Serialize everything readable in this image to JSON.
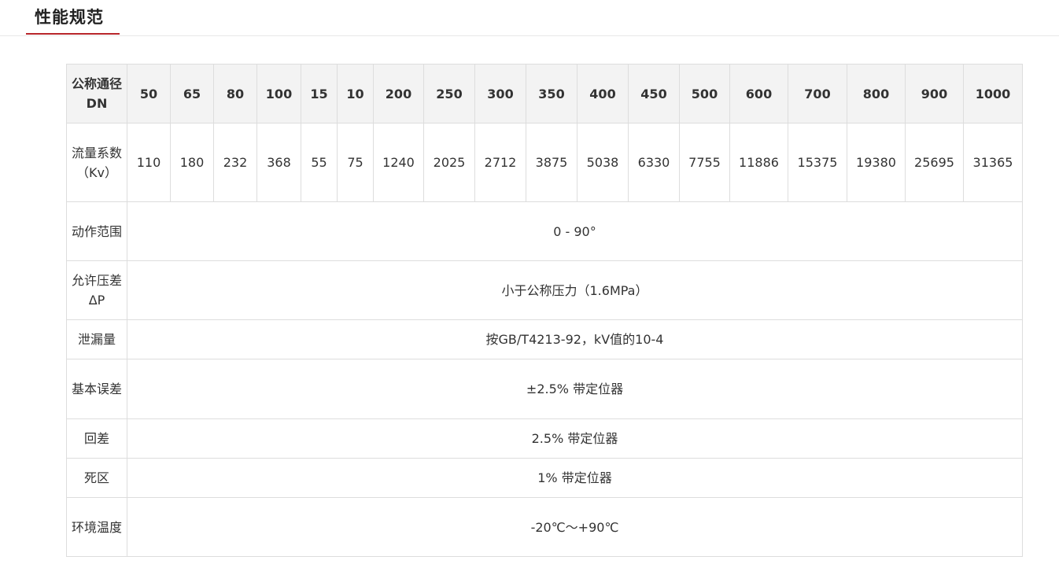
{
  "section": {
    "title": "性能规范"
  },
  "table": {
    "header_label": "公称通径DN",
    "dn_values": [
      "50",
      "65",
      "80",
      "100",
      "15",
      "10",
      "200",
      "250",
      "300",
      "350",
      "400",
      "450",
      "500",
      "600",
      "700",
      "800",
      "900",
      "1000"
    ],
    "kv_label": "流量系数（Kv）",
    "kv_values": [
      "110",
      "180",
      "232",
      "368",
      "55",
      "75",
      "1240",
      "2025",
      "2712",
      "3875",
      "5038",
      "6330",
      "7755",
      "11886",
      "15375",
      "19380",
      "25695",
      "31365"
    ],
    "rows": [
      {
        "label": "动作范围",
        "value": "0 - 90°"
      },
      {
        "label": "允许压差ΔP",
        "value": "小于公称压力（1.6MPa）"
      },
      {
        "label": "泄漏量",
        "value": "按GB/T4213-92，kV值的10-4"
      },
      {
        "label": "基本误差",
        "value": "±2.5% 带定位器"
      },
      {
        "label": "回差",
        "value": "2.5% 带定位器"
      },
      {
        "label": "死区",
        "value": "1% 带定位器"
      },
      {
        "label": "环境温度",
        "value": "-20℃～+90℃"
      }
    ]
  }
}
